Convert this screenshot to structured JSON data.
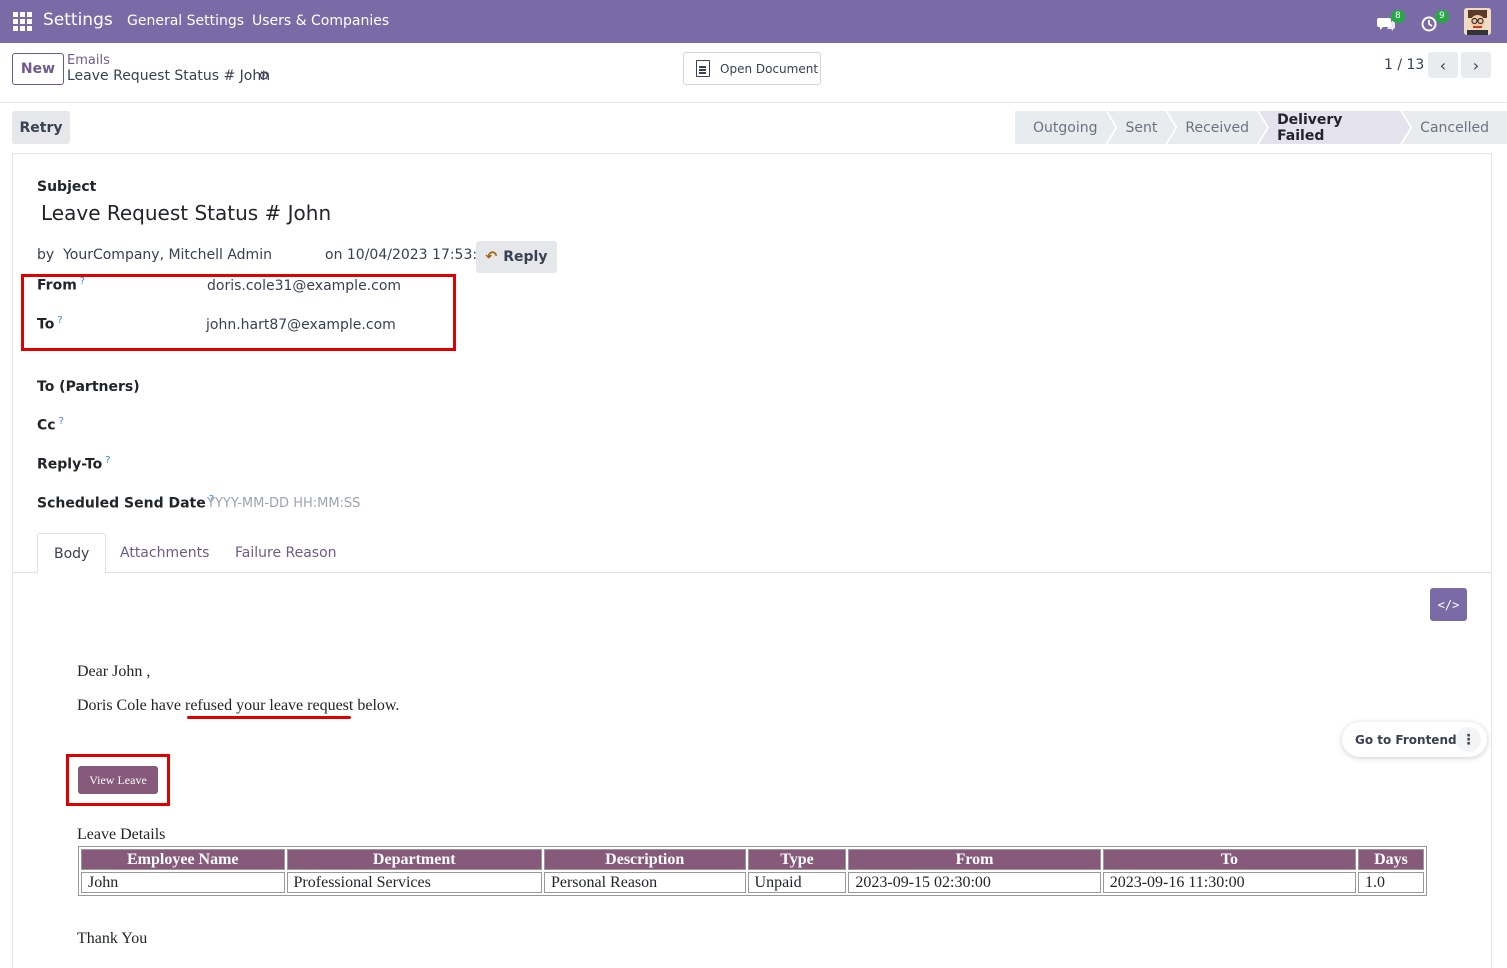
{
  "navbar": {
    "brand": "Settings",
    "menu": [
      "General Settings",
      "Users & Companies"
    ],
    "chat_count": "8",
    "activity_count": "9",
    "bg_color": "#7a6ba6"
  },
  "control_panel": {
    "new_label": "New",
    "breadcrumb_parent": "Emails",
    "breadcrumb_current": "Leave Request Status # John",
    "open_document_label": "Open Document",
    "pager": "1 / 13"
  },
  "statusbar": {
    "retry_label": "Retry",
    "stages": [
      "Outgoing",
      "Sent",
      "Received",
      "Delivery Failed",
      "Cancelled"
    ],
    "active_stage": "Delivery Failed"
  },
  "form": {
    "subject_label": "Subject",
    "subject_value": "Leave Request Status # John",
    "by_prefix": "by",
    "author": "YourCompany, Mitchell Admin",
    "date_line": "on 10/04/2023 17:53:31",
    "reply_label": "Reply",
    "from_label": "From",
    "from_value": "doris.cole31@example.com",
    "to_label": "To",
    "to_value": "john.hart87@example.com",
    "to_partners_label": "To (Partners)",
    "cc_label": "Cc",
    "reply_to_label": "Reply-To",
    "scheduled_label": "Scheduled Send Date",
    "scheduled_placeholder": "YYYY-MM-DD HH:MM:SS",
    "help_mark": "?"
  },
  "tabs": [
    "Body",
    "Attachments",
    "Failure Reason"
  ],
  "email_body": {
    "greeting": "Dear John ,",
    "line_before": "Doris Cole have ",
    "line_underlined": "refused your leave request",
    "line_after": " below.",
    "button_label": "View Leave",
    "details_title": "Leave Details",
    "table_headers": [
      "Employee Name",
      "Department",
      "Description",
      "Type",
      "From",
      "To",
      "Days"
    ],
    "table_row": [
      "John",
      "Professional Services",
      "Personal Reason",
      "Unpaid",
      "2023-09-15 02:30:00",
      "2023-09-16 11:30:00",
      "1.0"
    ],
    "closing": "Thank You"
  },
  "floating": {
    "go_frontend_label": "Go to Frontend"
  }
}
